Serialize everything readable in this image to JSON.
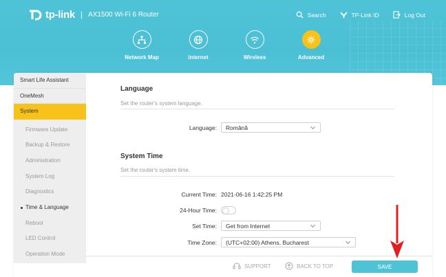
{
  "header": {
    "brand": "tp-link",
    "separator": "|",
    "model": "AX1500 Wi-Fi 6 Router",
    "links": [
      {
        "label": "Search",
        "icon": "search-icon"
      },
      {
        "label": "TP-Link ID",
        "icon": "tplink-id-icon"
      },
      {
        "label": "Log Out",
        "icon": "logout-icon"
      }
    ],
    "nav": [
      {
        "label": "Network Map",
        "icon": "network-map-icon"
      },
      {
        "label": "Internet",
        "icon": "globe-icon"
      },
      {
        "label": "Wireless",
        "icon": "wifi-icon"
      },
      {
        "label": "Advanced",
        "icon": "gear-icon",
        "active": true
      }
    ],
    "accent": "#4fc3d6",
    "active_color": "#f7c31b"
  },
  "sidebar": {
    "top_items": [
      "Smart Life Assistant",
      "OneMesh",
      "System"
    ],
    "sub_items": [
      "Firmware Update",
      "Backup & Restore",
      "Administration",
      "System Log",
      "Diagnostics",
      "Time & Language",
      "Reboot",
      "LED Control",
      "Operation Mode"
    ],
    "current_sub": "Time & Language"
  },
  "main": {
    "language": {
      "title": "Language",
      "desc": "Set the router's system language.",
      "field_label": "Language:",
      "value": "Română"
    },
    "system_time": {
      "title": "System Time",
      "desc": "Set the router's system time.",
      "current_time_label": "Current Time:",
      "current_time_value": "2021-06-16 1:42:25 PM",
      "hour24_label": "24-Hour Time:",
      "hour24_enabled": false,
      "set_time_label": "Set Time:",
      "set_time_value": "Get from Internet",
      "time_zone_label": "Time Zone:",
      "time_zone_value": "(UTC+02:00) Athens, Bucharest"
    }
  },
  "footer": {
    "support": "SUPPORT",
    "back_to_top": "BACK TO TOP",
    "save": "SAVE"
  },
  "annotation": {
    "arrow_color": "#e02020"
  }
}
